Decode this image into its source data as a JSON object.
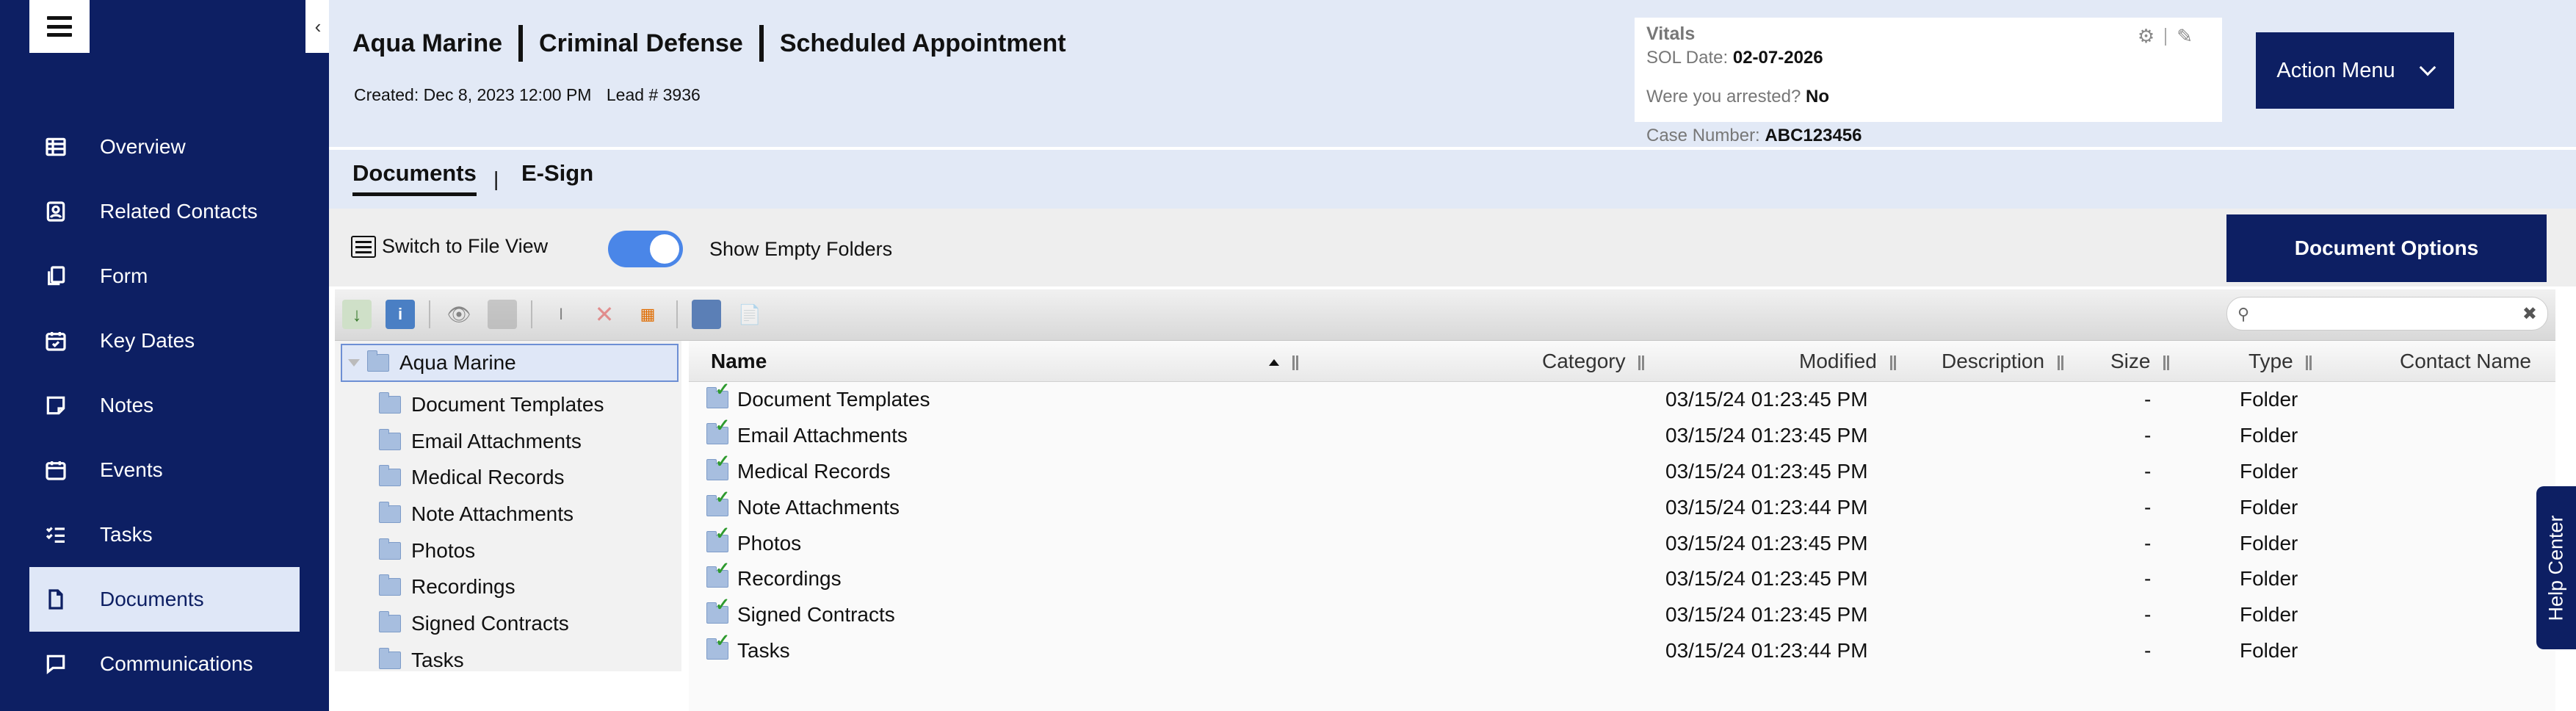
{
  "sidebar": {
    "items": [
      {
        "label": "Overview",
        "icon": "table-icon"
      },
      {
        "label": "Related Contacts",
        "icon": "contact-card-icon"
      },
      {
        "label": "Form",
        "icon": "form-pages-icon"
      },
      {
        "label": "Key Dates",
        "icon": "calendar-check-icon"
      },
      {
        "label": "Notes",
        "icon": "note-icon"
      },
      {
        "label": "Events",
        "icon": "calendar-icon"
      },
      {
        "label": "Tasks",
        "icon": "checklist-icon"
      },
      {
        "label": "Documents",
        "icon": "document-icon",
        "active": true
      },
      {
        "label": "Communications",
        "icon": "chat-bubble-icon"
      }
    ]
  },
  "header": {
    "client": "Aqua Marine",
    "case_type": "Criminal Defense",
    "status": "Scheduled Appointment",
    "created": "Created: Dec 8, 2023 12:00 PM",
    "lead": "Lead # 3936"
  },
  "vitals": {
    "title": "Vitals",
    "sol_label": "SOL Date:",
    "sol_value": "02-07-2026",
    "arrested_label": "Were you arrested?",
    "arrested_value": "No",
    "case_label": "Case Number:",
    "case_value": "ABC123456"
  },
  "action_menu": {
    "label": "Action Menu"
  },
  "tabs": [
    {
      "label": "Documents",
      "active": true
    },
    {
      "label": "E-Sign"
    }
  ],
  "tab_separator": "|",
  "toolbar": {
    "switch_view_label": "Switch to File View",
    "show_empty_label": "Show Empty Folders",
    "show_empty_on": true,
    "document_options_label": "Document Options"
  },
  "tree": {
    "root": "Aqua Marine",
    "folders": [
      "Document Templates",
      "Email Attachments",
      "Medical Records",
      "Note Attachments",
      "Photos",
      "Recordings",
      "Signed Contracts",
      "Tasks"
    ]
  },
  "grid": {
    "columns": {
      "name": "Name",
      "category": "Category",
      "modified": "Modified",
      "description": "Description",
      "size": "Size",
      "type": "Type",
      "contact": "Contact Name"
    },
    "rows": [
      {
        "name": "Document Templates",
        "modified": "03/15/24 01:23:45 PM",
        "size": "-",
        "type": "Folder"
      },
      {
        "name": "Email Attachments",
        "modified": "03/15/24 01:23:45 PM",
        "size": "-",
        "type": "Folder"
      },
      {
        "name": "Medical Records",
        "modified": "03/15/24 01:23:45 PM",
        "size": "-",
        "type": "Folder"
      },
      {
        "name": "Note Attachments",
        "modified": "03/15/24 01:23:44 PM",
        "size": "-",
        "type": "Folder"
      },
      {
        "name": "Photos",
        "modified": "03/15/24 01:23:45 PM",
        "size": "-",
        "type": "Folder"
      },
      {
        "name": "Recordings",
        "modified": "03/15/24 01:23:45 PM",
        "size": "-",
        "type": "Folder"
      },
      {
        "name": "Signed Contracts",
        "modified": "03/15/24 01:23:45 PM",
        "size": "-",
        "type": "Folder"
      },
      {
        "name": "Tasks",
        "modified": "03/15/24 01:23:44 PM",
        "size": "-",
        "type": "Folder"
      }
    ]
  },
  "help": {
    "label": "Help Center"
  },
  "colors": {
    "navy": "#0d1f63",
    "header_bg": "#e2e9f6",
    "toggle_blue": "#4a86e8"
  }
}
